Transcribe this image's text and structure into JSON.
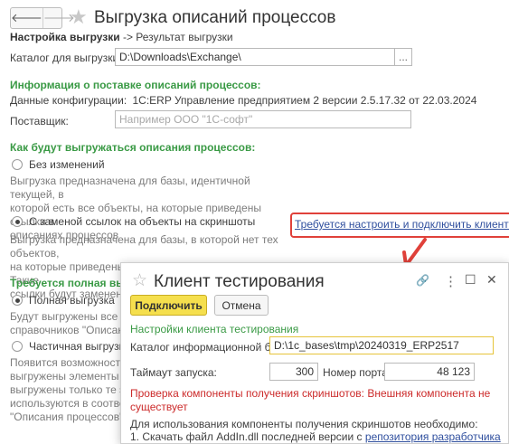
{
  "header": {
    "back_arrow": "🡐",
    "forward_arrow": "🡒",
    "star": "★",
    "title": "Выгрузка описаний процессов"
  },
  "breadcrumb": {
    "current": "Настройка выгрузки",
    "separator": " -> ",
    "next": "Результат выгрузки"
  },
  "export_dir": {
    "label": "Каталог для выгрузки:",
    "value": "D:\\Downloads\\Exchange\\",
    "button": "..."
  },
  "supply_info": {
    "heading": "Информация о поставке описаний процессов:",
    "config_label": "Данные конфигурации:",
    "config_value": "1С:ERP Управление предприятием 2 версии 2.5.17.32 от 22.03.2024",
    "supplier_label": "Поставщик:",
    "supplier_placeholder": "Например ООО \"1С-софт\""
  },
  "export_mode": {
    "heading": "Как будут выгружаться описания процессов:",
    "option1_label": "Без изменений",
    "option1_desc": [
      "Выгрузка предназначена для базы, идентичной текущей, в",
      "которой есть все объекты, на которые приведены ссылки в",
      "описаниях процессов"
    ],
    "option2_label": "С заменой ссылок на объекты на скриншоты",
    "option2_desc": [
      "Выгрузка предназначена для базы, в которой нет тех объектов,",
      "на которые приведены ссылки в описаниях процессов. Такие",
      "ссылки будут заменены на скриншоты"
    ],
    "configure_link": "Требуется настроить и подключить клиент тес"
  },
  "full_export": {
    "heading": "Требуется полная выгр",
    "option1_label": "Полная выгрузка",
    "option1_desc": [
      "Будут выгружены все не",
      "справочников \"Описания"
    ],
    "option2_label": "Частичная выгрузка",
    "option2_desc": [
      "Появится возможность н",
      "выгружены элементы спр",
      "выгружены только те эле",
      "используются в соответс",
      "\"Описания процессов\""
    ]
  },
  "dialog": {
    "star": "☆",
    "title": "Клиент тестирования",
    "link_icon": "🔗",
    "more_icon": "⋮",
    "maximize_icon": "☐",
    "close_icon": "✕",
    "connect_button": "Подключить",
    "cancel_button": "Отмена",
    "section_heading": "Настройки клиента тестирования",
    "infobase_label": "Каталог информационной базы:",
    "infobase_value": "D:\\1c_bases\\tmp\\20240319_ERP2517",
    "timeout_label": "Таймаут запуска:",
    "timeout_value": "300",
    "port_label": "Номер порта:",
    "port_value": "48 123",
    "error_lines": [
      "Проверка компоненты получения скриншотов: Внешняя компонента не",
      "существует"
    ],
    "info_line1": "Для использования компоненты получения скриншотов необходимо:",
    "info_line2": "1. Скачать файл AddIn.dll последней версии с ",
    "info_link": "репозитория разработчика"
  },
  "colors": {
    "accent_green": "#3a9a45",
    "highlight_red": "#e0413a",
    "primary_button": "#f5df4d",
    "link_blue": "#2f4f9e",
    "error_red": "#cc2b2b"
  }
}
